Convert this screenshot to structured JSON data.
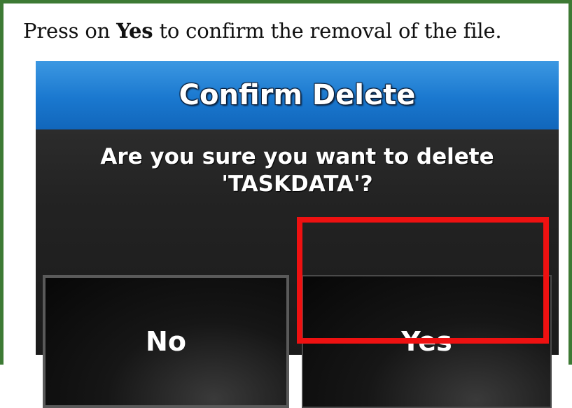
{
  "instruction": {
    "prefix": "Press on ",
    "emphasis": "Yes",
    "suffix": " to confirm the removal of the file."
  },
  "dialog": {
    "title": "Confirm Delete",
    "message_line1": "Are you sure you want to delete",
    "message_line2": "'TASKDATA'?",
    "buttons": {
      "no_label": "No",
      "yes_label": "Yes"
    }
  },
  "colors": {
    "frame_border": "#3d7a34",
    "title_bar": "#1a78cf",
    "highlight": "#ee1111"
  }
}
